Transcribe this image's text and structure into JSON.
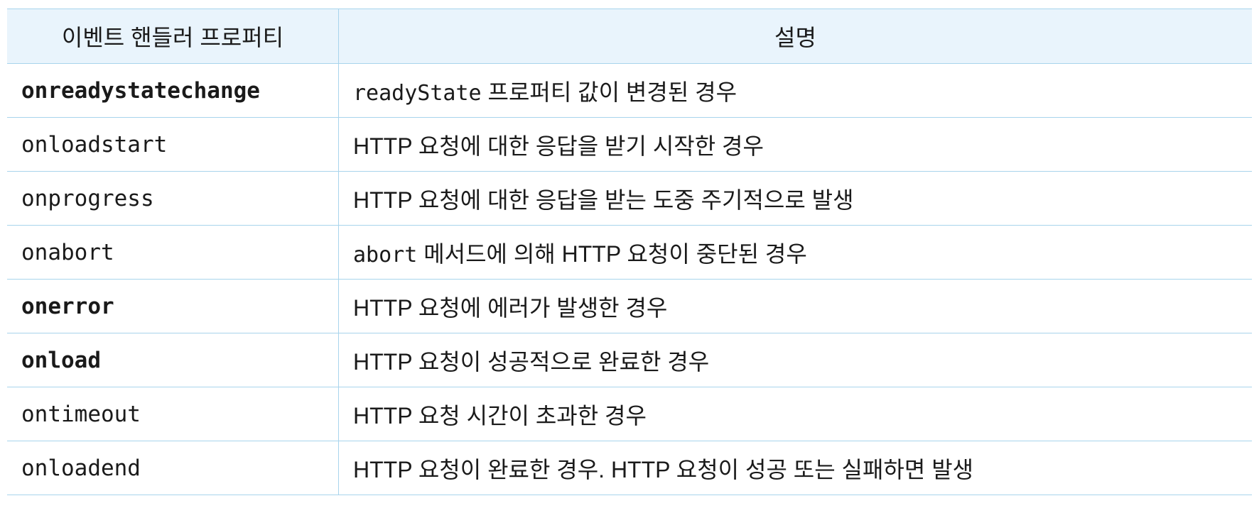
{
  "header": {
    "col1": "이벤트 핸들러 프로퍼티",
    "col2": "설명"
  },
  "rows": [
    {
      "prop": "onreadystatechange",
      "bold": true,
      "desc_code": "readyState",
      "desc": " 프로퍼티 값이 변경된 경우"
    },
    {
      "prop": "onloadstart",
      "bold": false,
      "desc_code": "",
      "desc": "HTTP 요청에 대한 응답을 받기 시작한 경우"
    },
    {
      "prop": "onprogress",
      "bold": false,
      "desc_code": "",
      "desc": "HTTP 요청에 대한 응답을 받는 도중 주기적으로 발생"
    },
    {
      "prop": "onabort",
      "bold": false,
      "desc_code": "abort",
      "desc": " 메서드에 의해 HTTP 요청이 중단된 경우"
    },
    {
      "prop": "onerror",
      "bold": true,
      "desc_code": "",
      "desc": "HTTP 요청에 에러가 발생한 경우"
    },
    {
      "prop": "onload",
      "bold": true,
      "desc_code": "",
      "desc": "HTTP 요청이 성공적으로 완료한 경우"
    },
    {
      "prop": "ontimeout",
      "bold": false,
      "desc_code": "",
      "desc": "HTTP 요청 시간이 초과한 경우"
    },
    {
      "prop": "onloadend",
      "bold": false,
      "desc_code": "",
      "desc": "HTTP 요청이 완료한 경우. HTTP 요청이 성공 또는 실패하면 발생"
    }
  ]
}
